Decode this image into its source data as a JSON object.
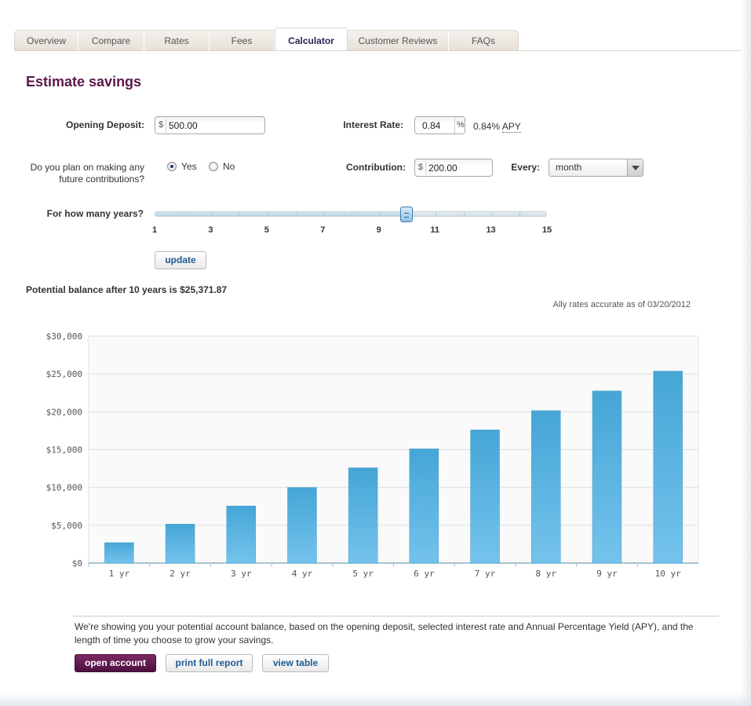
{
  "tabs": [
    {
      "label": "Overview"
    },
    {
      "label": "Compare"
    },
    {
      "label": "Rates"
    },
    {
      "label": "Fees"
    },
    {
      "label": "Calculator",
      "active": true
    },
    {
      "label": "Customer Reviews"
    },
    {
      "label": "FAQs"
    }
  ],
  "page_title": "Estimate savings",
  "form": {
    "opening_deposit_label": "Opening Deposit:",
    "opening_deposit_prefix": "$",
    "opening_deposit_value": "500.00",
    "interest_rate_label": "Interest Rate:",
    "interest_rate_value": "0.84",
    "interest_rate_suffix": "%",
    "apy_value": "0.84%",
    "apy_label": "APY",
    "contributions_question": "Do you plan on making any future contributions?",
    "yes_label": "Yes",
    "no_label": "No",
    "contribution_selected": "Yes",
    "contribution_label": "Contribution:",
    "contribution_prefix": "$",
    "contribution_value": "200.00",
    "every_label": "Every:",
    "every_value": "month",
    "years_label": "For how many years?",
    "years_value": 10,
    "years_min": 1,
    "years_max": 15,
    "years_tick_labels": [
      "1",
      "3",
      "5",
      "7",
      "9",
      "11",
      "13",
      "15"
    ],
    "update_label": "update"
  },
  "result": {
    "balance_text": "Potential balance after 10 years is $25,371.87",
    "rates_note": "Ally rates accurate as of 03/20/2012"
  },
  "chart_data": {
    "type": "bar",
    "categories": [
      "1 yr",
      "2 yr",
      "3 yr",
      "4 yr",
      "5 yr",
      "6 yr",
      "7 yr",
      "8 yr",
      "9 yr",
      "10 yr"
    ],
    "values": [
      2700,
      5150,
      7550,
      10000,
      12600,
      15100,
      17600,
      20150,
      22750,
      25371.87
    ],
    "ylim": [
      0,
      30000
    ],
    "yticks": [
      0,
      5000,
      10000,
      15000,
      20000,
      25000,
      30000
    ],
    "ytick_labels": [
      "$0",
      "$5,000",
      "$10,000",
      "$15,000",
      "$20,000",
      "$25,000",
      "$30,000"
    ],
    "grid": true,
    "bar_color": "#5ab3e1"
  },
  "footer": {
    "disclaimer": "We're showing you your potential account balance, based on the opening deposit, selected interest rate and Annual Percentage Yield (APY), and the length of time you choose to grow your savings.",
    "open_account_label": "open account",
    "print_report_label": "print full report",
    "view_table_label": "view table"
  },
  "colors": {
    "brand_purple": "#5c1849",
    "link_blue": "#1e5b93"
  }
}
